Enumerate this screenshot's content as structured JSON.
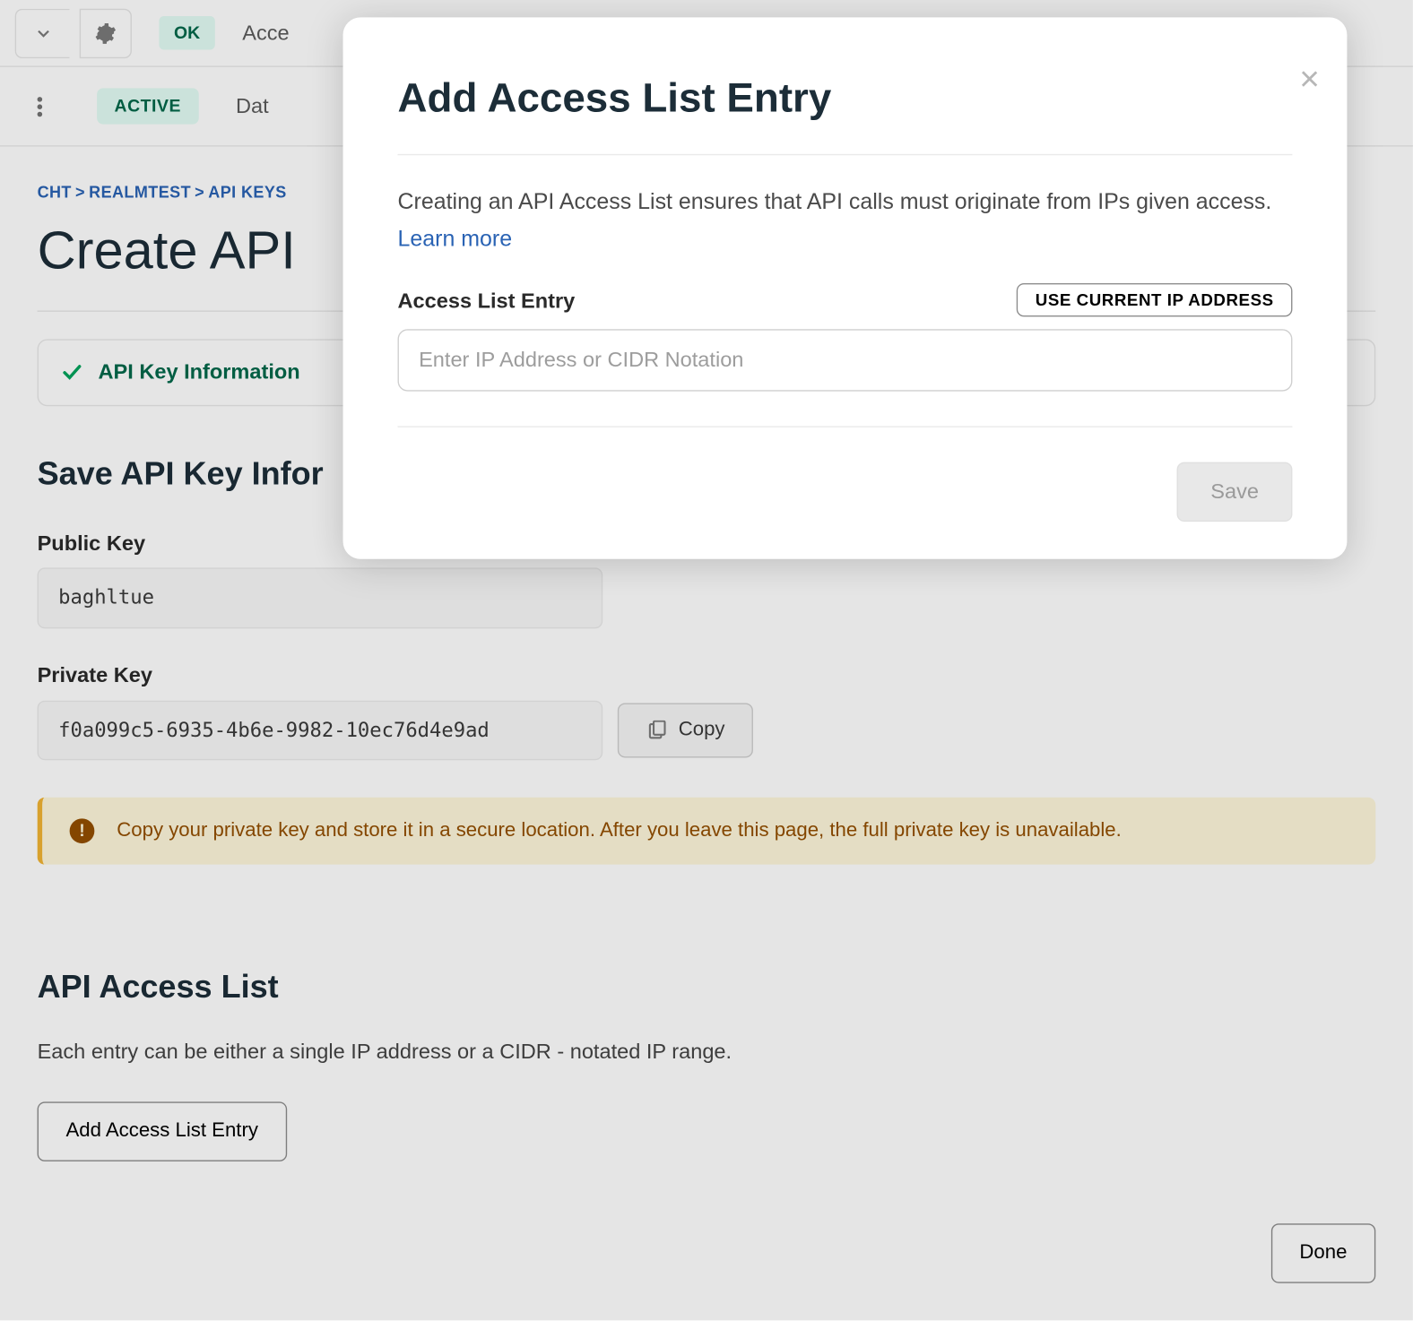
{
  "topbar": {
    "ok_label": "OK",
    "access_label": "Acce"
  },
  "tabbar": {
    "active_label": "ACTIVE",
    "data_label": "Dat"
  },
  "breadcrumb": {
    "items": [
      "CHT",
      "REALMTEST",
      "API KEYS"
    ]
  },
  "page_title": "Create API ",
  "step_banner": "API Key Information",
  "section_save_title": "Save API Key Infor",
  "public_key": {
    "label": "Public Key",
    "value": "baghltue"
  },
  "private_key": {
    "label": "Private Key",
    "value": "f0a099c5-6935-4b6e-9982-10ec76d4e9ad",
    "copy_label": "Copy"
  },
  "warning_text": "Copy your private key and store it in a secure location. After you leave this page, the full private key is unavailable.",
  "access_list": {
    "title": "API Access List",
    "description": "Each entry can be either a single IP address or a CIDR - notated IP range.",
    "add_button": "Add Access List Entry"
  },
  "done_label": "Done",
  "modal": {
    "title": "Add Access List Entry",
    "description": "Creating an API Access List ensures that API calls must originate from IPs given access.",
    "learn_more": "Learn more",
    "entry_label": "Access List Entry",
    "use_ip_button": "USE CURRENT IP ADDRESS",
    "input_placeholder": "Enter IP Address or CIDR Notation",
    "save_label": "Save"
  }
}
